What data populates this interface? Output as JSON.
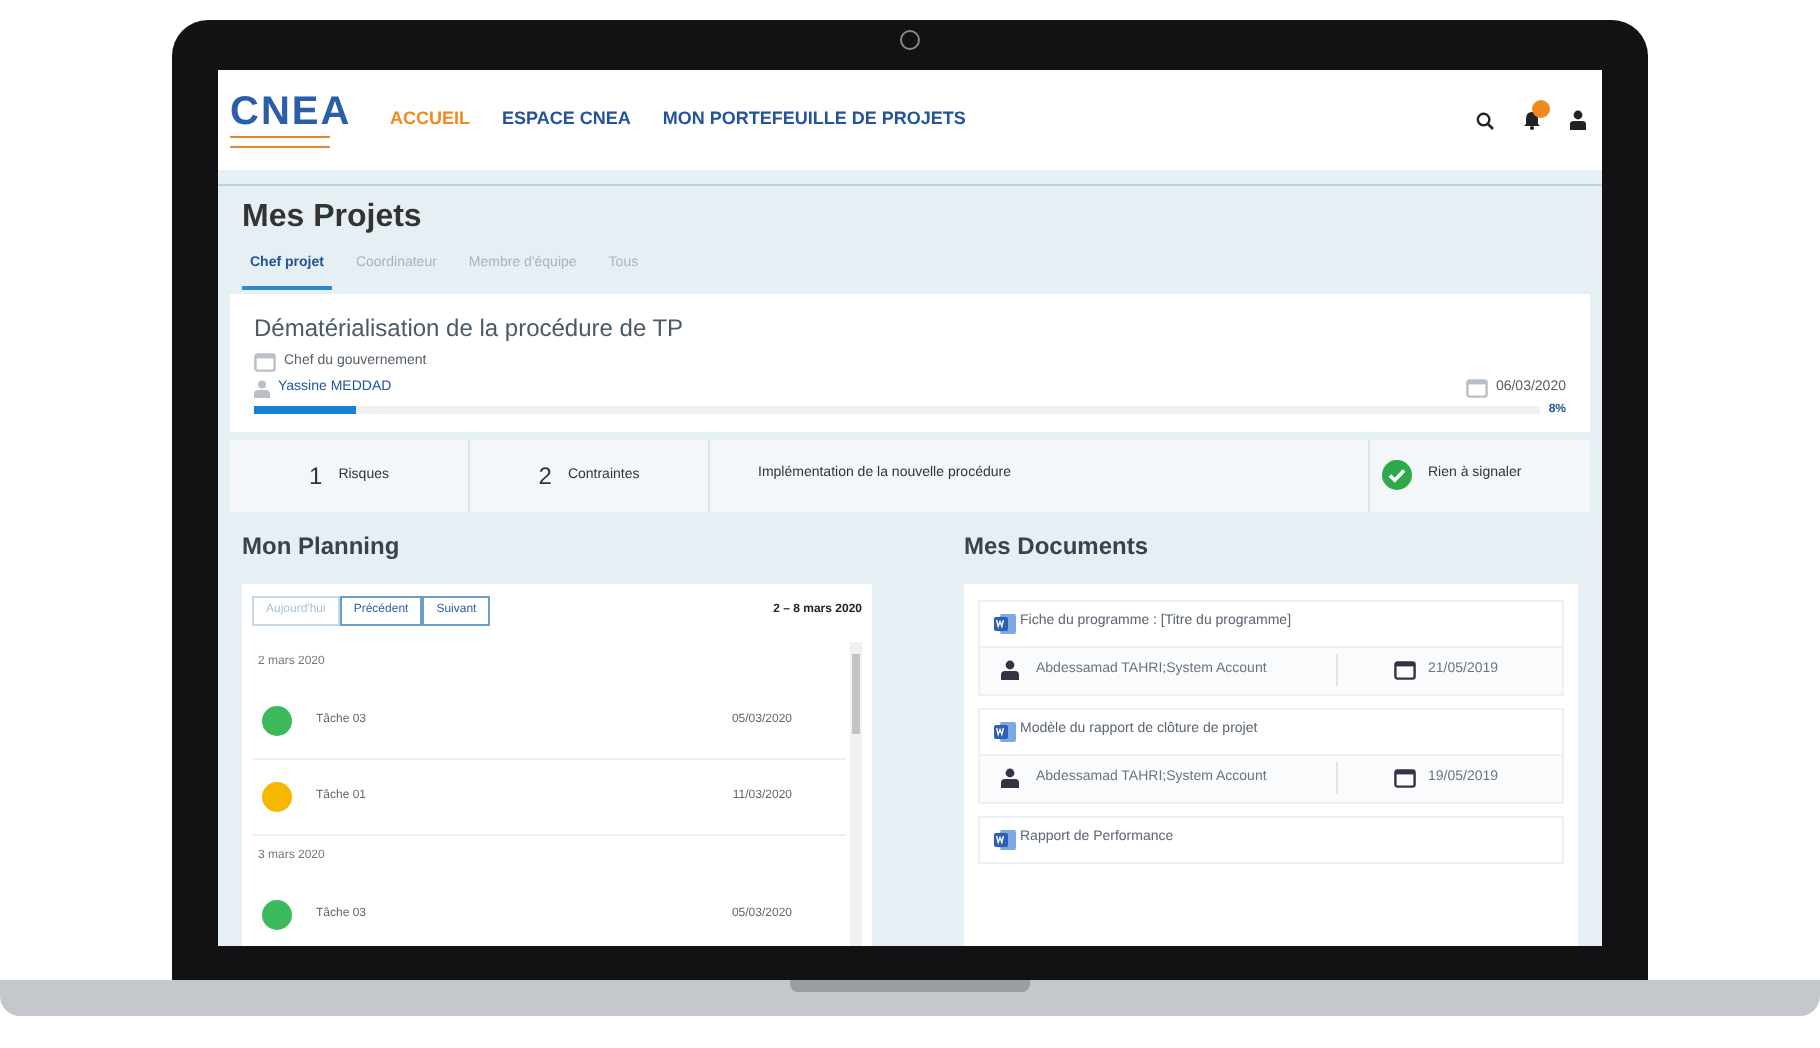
{
  "nav": {
    "logo": "CNEA",
    "items": [
      {
        "label": "ACCUEIL",
        "selected": true
      },
      {
        "label": "ESPACE CNEA",
        "selected": false
      },
      {
        "label": "MON PORTEFEUILLE DE PROJETS",
        "selected": false
      }
    ]
  },
  "projects": {
    "title": "Mes Projets",
    "tabs": [
      {
        "label": "Chef projet",
        "selected": true
      },
      {
        "label": "Coordinateur",
        "selected": false
      },
      {
        "label": "Membre d'équipe",
        "selected": false
      },
      {
        "label": "Tous",
        "selected": false
      }
    ],
    "project": {
      "title": "Dématérialisation de la procédure de TP",
      "organization": "Chef du gouvernement",
      "owner": "Yassine MEDDAD",
      "date": "06/03/2020",
      "progress": "8%",
      "level": 0.08
    },
    "stats": [
      {
        "kind": "count",
        "value": "1",
        "label": "Risques"
      },
      {
        "kind": "count",
        "value": "2",
        "label": "Contraintes"
      },
      {
        "kind": "text",
        "label": "Implémentation de la nouvelle procédure"
      },
      {
        "kind": "status",
        "label": "Rien à signaler"
      }
    ]
  },
  "planning": {
    "title": "Mon Planning",
    "buttons": [
      {
        "label": "Aujourd'hui",
        "disabled": true
      },
      {
        "label": "Précédent",
        "disabled": false
      },
      {
        "label": "Suivant",
        "disabled": false
      }
    ],
    "range": "2 – 8 mars 2020",
    "groups": [
      {
        "date": "2 mars 2020",
        "tasks": [
          {
            "name": "Tâche 03",
            "due": "05/03/2020",
            "color": "#3cb95a"
          },
          {
            "name": "Tâche 01",
            "due": "11/03/2020",
            "color": "#f5b800"
          }
        ]
      },
      {
        "date": "3 mars 2020",
        "tasks": [
          {
            "name": "Tâche 03",
            "due": "05/03/2020",
            "color": "#3cb95a"
          }
        ]
      }
    ]
  },
  "documents": {
    "title": "Mes Documents",
    "items": [
      {
        "title": "Fiche du programme : [Titre du programme]",
        "author": "Abdessamad TAHRI;System Account",
        "date": "21/05/2019"
      },
      {
        "title": "Modèle du rapport de clôture de projet",
        "author": "Abdessamad TAHRI;System Account",
        "date": "19/05/2019"
      },
      {
        "title": "Rapport de Performance"
      }
    ]
  }
}
